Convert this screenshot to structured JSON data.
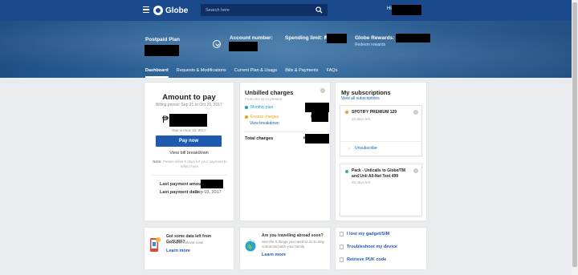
{
  "header": {
    "logo_text": "Globe",
    "search_placeholder": "Search here",
    "greeting": "Hi,"
  },
  "banner": {
    "plan_label": "Postpaid Plan",
    "account_label": "Account number:",
    "spending_label": "Spending limit: ₱",
    "rewards_label": "Globe Rewards:",
    "redeem_link": "Redeem rewards"
  },
  "tabs": [
    {
      "label": "Dashboard",
      "active": true
    },
    {
      "label": "Requests & Modifications",
      "active": false
    },
    {
      "label": "Current Plan & Usage",
      "active": false
    },
    {
      "label": "Bills & Payments",
      "active": false
    },
    {
      "label": "FAQs",
      "active": false
    }
  ],
  "amount_card": {
    "title": "Amount to pay",
    "billing_period": "Billing period: Sep 21 to Oct 20, 2017",
    "currency": "₱",
    "due": "Due on Nov 10, 2017",
    "pay_button": "Pay now",
    "view_breakdown": "View bill breakdown",
    "note_label": "Note:",
    "note_text": "Please allow 5 days for your payment to reflect here.",
    "last_payment_amount_label": "Last payment amount:",
    "last_payment_date_label": "Last payment date:",
    "last_payment_date": "Sep 03, 2017"
  },
  "unbilled_card": {
    "title": "Unbilled charges",
    "from": "From Oct 21 to present",
    "monthly_plan": "Monthly plan",
    "excess": "Excess charges",
    "view_breakdown": "View breakdown",
    "total_label": "Total charges",
    "currency": "₱",
    "info_glyph": "i",
    "colors": {
      "monthly": "#1a9fc9",
      "excess": "#e6a300"
    }
  },
  "subscriptions_card": {
    "title": "My subscriptions",
    "view_all": "View all subscriptions",
    "items": [
      {
        "name": "SPOTIFY PREMIUM 129",
        "days": "25 days left",
        "color": "#f0a030",
        "action": "Unsubscribe"
      },
      {
        "name": "Pack - Unlicalls to Globe/TM and Unli All-Net Text 499",
        "days": "25 days left",
        "color": "#2bb3a8"
      }
    ]
  },
  "promo1": {
    "title": "Got some data left from GoSURF?",
    "sub": "Get Data Rollover now!",
    "link": "Learn more"
  },
  "promo2": {
    "title": "Are you travelling abroad soon?",
    "sub": "See the 5 things you need to do to stay connected with your family.",
    "link": "Learn more"
  },
  "help": [
    {
      "label": "I lost my gadget/SIM",
      "icon": "phone-icon"
    },
    {
      "label": "Troubleshoot my device",
      "icon": "wrench-icon"
    },
    {
      "label": "Retrieve PUK code",
      "icon": "lock-icon"
    }
  ]
}
